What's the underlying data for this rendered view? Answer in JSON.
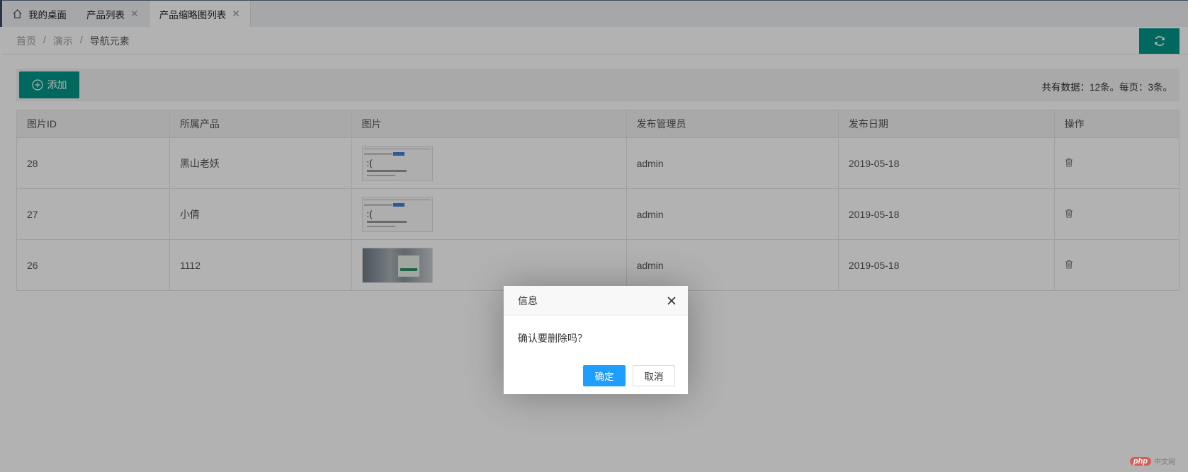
{
  "tabs": [
    {
      "label": "我的桌面",
      "icon": "home-icon",
      "closable": false,
      "active": false
    },
    {
      "label": "产品列表",
      "closable": true,
      "active": false
    },
    {
      "label": "产品缩略图列表",
      "closable": true,
      "active": true
    }
  ],
  "breadcrumb": {
    "home": "首页",
    "sep": "/",
    "level2": "演示",
    "current": "导航元素"
  },
  "toolbar": {
    "add_label": "添加",
    "total_text": "共有数据：12条。每页：3条。"
  },
  "table": {
    "columns": [
      "图片ID",
      "所属产品",
      "图片",
      "发布管理员",
      "发布日期",
      "操作"
    ],
    "rows": [
      {
        "id": "28",
        "product": "黑山老妖",
        "thumb": "error-page",
        "face": ":(",
        "admin": "admin",
        "date": "2019-05-18"
      },
      {
        "id": "27",
        "product": "小倩",
        "thumb": "error-page",
        "face": ":(",
        "admin": "admin",
        "date": "2019-05-18"
      },
      {
        "id": "26",
        "product": "1112",
        "thumb": "photo",
        "admin": "admin",
        "date": "2019-05-18"
      }
    ]
  },
  "dialog": {
    "title": "信息",
    "message": "确认要删除吗？",
    "ok_label": "确定",
    "cancel_label": "取消"
  },
  "watermark": {
    "brand": "php",
    "text": "中文网"
  },
  "colors": {
    "primary": "#009688",
    "confirm": "#1e9fff",
    "overlay": "rgba(0,0,0,0.3)"
  }
}
